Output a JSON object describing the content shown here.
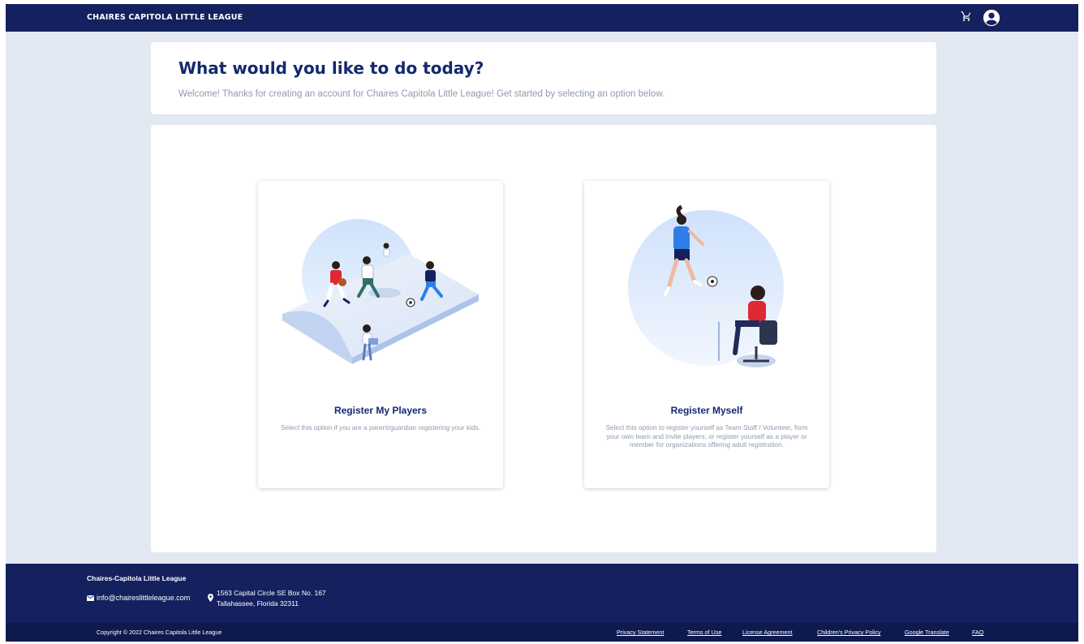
{
  "header": {
    "brand": "CHAIRES CAPITOLA LITTLE LEAGUE",
    "cart_icon": "cart-icon",
    "account_icon": "account-circle-icon"
  },
  "welcome": {
    "title": "What would you like to do today?",
    "subtitle": "Welcome! Thanks for creating an account for Chaires Capitola Little League! Get started by selecting an option below."
  },
  "options": [
    {
      "title": "Register My Players",
      "description": "Select this option if you are a parent/guardian registering your kids.",
      "illustration": "players-illustration"
    },
    {
      "title": "Register Myself",
      "description": "Select this option to register yourself as Team Staff / Volunteer, form your own team and invite players, or register yourself as a player or member for organizations offering adult registration.",
      "illustration": "myself-illustration"
    }
  ],
  "footer": {
    "org_name": "Chaires-Capitola Little League",
    "email": "info@chaireslittleleague.com",
    "address_line1": "1563 Capital Circle SE Box No. 167",
    "address_line2": "Tallahassee, Florida 32311",
    "copyright": "Copyright © 2022 Chaires Capitola Little League",
    "links": [
      "Privacy Statement",
      "Terms of Use",
      "License Agreement",
      "Children's Privacy Policy",
      "Google Translate",
      "FAQ"
    ]
  },
  "colors": {
    "navy": "#14215e",
    "title_blue": "#13296e",
    "page_bg": "#e3e9f2",
    "muted_text": "#8d9ab0",
    "accent_red": "#e02833",
    "accent_blue": "#2f7ee8"
  }
}
